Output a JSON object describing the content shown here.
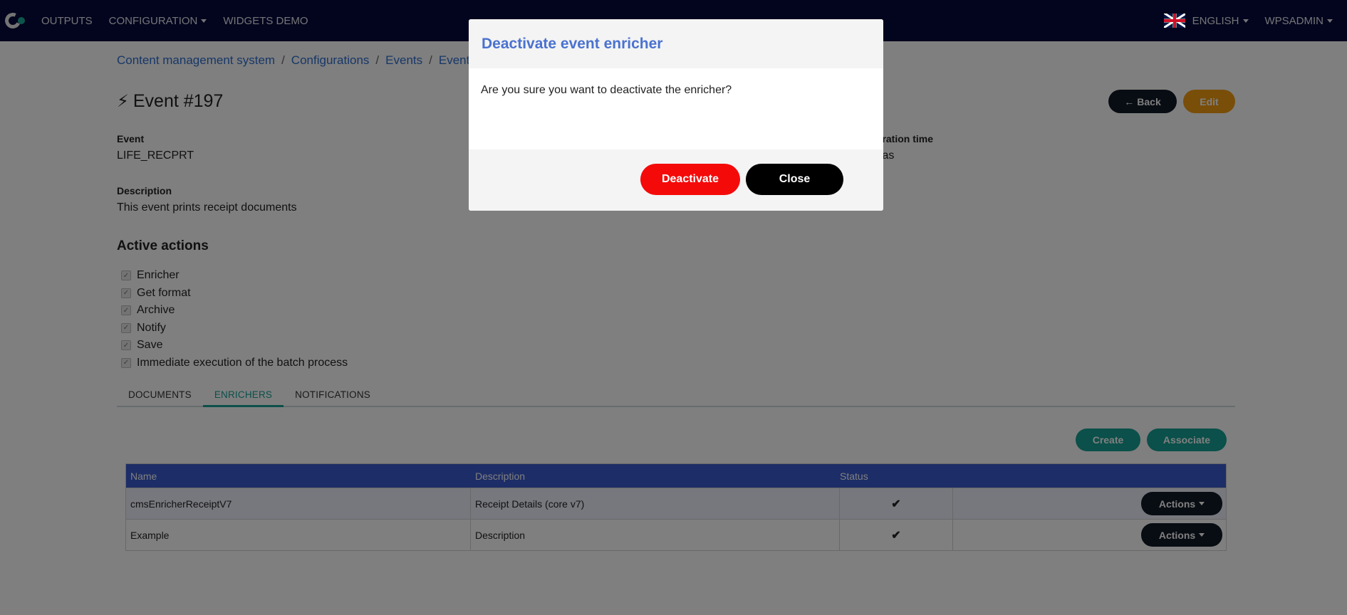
{
  "navbar": {
    "items": [
      {
        "label": "OUTPUTS"
      },
      {
        "label": "CONFIGURATION"
      },
      {
        "label": "WIDGETS DEMO"
      }
    ],
    "language": "ENGLISH",
    "user": "WPSADMIN"
  },
  "breadcrumb": [
    "Content management system",
    "Configurations",
    "Events",
    "Event"
  ],
  "page": {
    "title": "Event #197",
    "back_label": "Back",
    "edit_label": "Edit"
  },
  "fields": {
    "event_label": "Event",
    "event_value": "LIFE_RECPRT",
    "description_label": "Description",
    "description_value": "This event prints receipt documents",
    "expiration_label": "piration time",
    "expiration_value": "dias"
  },
  "active_actions": {
    "title": "Active actions",
    "items": [
      {
        "label": "Enricher",
        "checked": true
      },
      {
        "label": "Get format",
        "checked": true
      },
      {
        "label": "Archive",
        "checked": true
      },
      {
        "label": "Notify",
        "checked": true
      },
      {
        "label": "Save",
        "checked": true
      },
      {
        "label": "Immediate execution of the batch process",
        "checked": true
      }
    ]
  },
  "tabs": [
    {
      "label": "DOCUMENTS",
      "active": false
    },
    {
      "label": "ENRICHERS",
      "active": true
    },
    {
      "label": "NOTIFICATIONS",
      "active": false
    }
  ],
  "enrichers": {
    "create_label": "Create",
    "associate_label": "Associate",
    "columns": [
      "Name",
      "Description",
      "Status"
    ],
    "rows": [
      {
        "name": "cmsEnricherReceiptV7",
        "description": "Receipt Details (core v7)",
        "status": "active",
        "actions_label": "Actions"
      },
      {
        "name": "Example",
        "description": "Description",
        "status": "active",
        "actions_label": "Actions"
      }
    ]
  },
  "modal": {
    "title": "Deactivate event enricher",
    "message": "Are you sure you want to deactivate the enricher?",
    "deactivate_label": "Deactivate",
    "close_label": "Close"
  },
  "colors": {
    "navbar": "#050a3b",
    "accent_teal": "#17a095",
    "table_header": "#3b5bcf",
    "link": "#2f6fd0",
    "danger": "#f50a0a",
    "warning": "#f39c12"
  }
}
